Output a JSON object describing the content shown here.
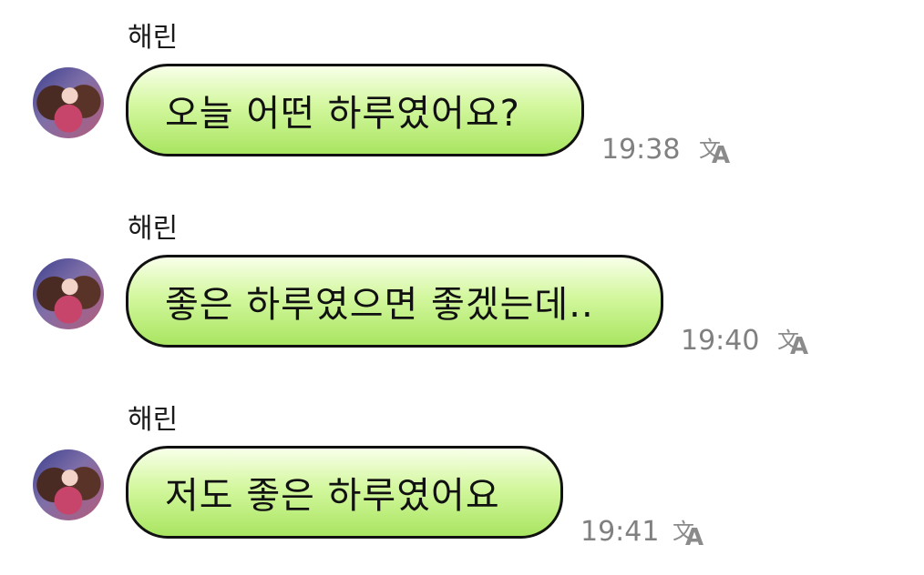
{
  "messages": [
    {
      "sender": "해린",
      "text": "오늘 어떤 하루였어요?",
      "time": "19:38"
    },
    {
      "sender": "해린",
      "text": "좋은 하루였으면 좋겠는데..",
      "time": "19:40"
    },
    {
      "sender": "해린",
      "text": "저도 좋은 하루였어요",
      "time": "19:41"
    }
  ],
  "icons": {
    "avatar": "profile-photo",
    "translate": "translate-icon"
  },
  "colors": {
    "bubble_top": "#f8ffe9",
    "bubble_bottom": "#a9e561",
    "bubble_border": "#111111",
    "time": "#808080"
  }
}
